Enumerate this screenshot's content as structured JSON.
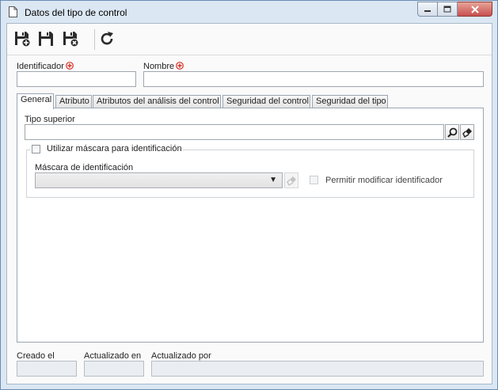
{
  "window": {
    "title": "Datos del tipo de control",
    "icons": {
      "title": "document-icon",
      "minimize": "minimize-icon",
      "maximize": "maximize-icon",
      "close": "close-icon"
    }
  },
  "toolbar": {
    "buttons": [
      {
        "name": "save-and-new-button",
        "icon": "save-new-icon"
      },
      {
        "name": "save-button",
        "icon": "save-icon"
      },
      {
        "name": "save-and-close-button",
        "icon": "save-close-icon"
      },
      {
        "name": "refresh-button",
        "icon": "refresh-icon"
      }
    ]
  },
  "form": {
    "identificador_label": "Identificador",
    "identificador_value": "",
    "nombre_label": "Nombre",
    "nombre_value": "",
    "required_icon": "required-icon"
  },
  "tabs": [
    {
      "label": "General",
      "active": true
    },
    {
      "label": "Atributo",
      "active": false
    },
    {
      "label": "Atributos del análisis del control",
      "active": false
    },
    {
      "label": "Seguridad del control",
      "active": false
    },
    {
      "label": "Seguridad del tipo",
      "active": false
    }
  ],
  "general": {
    "tipo_superior_label": "Tipo superior",
    "tipo_superior_value": "",
    "search_icon": "search-icon",
    "clear_icon": "eraser-icon",
    "mask_checkbox_label": "Utilizar máscara para identificación",
    "mask_checkbox_checked": false,
    "mask_label": "Máscara de identificación",
    "mask_value": "",
    "allow_modify_label": "Permitir modificar identificador",
    "allow_modify_checked": false
  },
  "footer": {
    "creado_label": "Creado el",
    "creado_value": "",
    "actualizado_en_label": "Actualizado en",
    "actualizado_en_value": "",
    "actualizado_por_label": "Actualizado por",
    "actualizado_por_value": ""
  },
  "colors": {
    "required": "#d93025",
    "window_frame": "#dbe7f3",
    "close_button": "#c75050"
  }
}
